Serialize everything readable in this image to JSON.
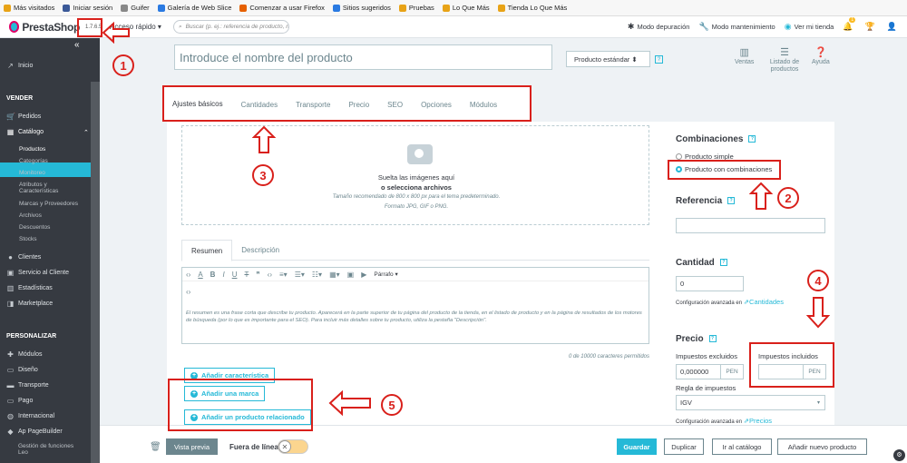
{
  "bookmarks": [
    {
      "label": "Más visitados",
      "color": "#e8a317"
    },
    {
      "label": "Iniciar sesión",
      "color": "#3b5998"
    },
    {
      "label": "Guifer",
      "color": "#888888"
    },
    {
      "label": "Galería de Web Slice",
      "color": "#2a7ae2"
    },
    {
      "label": "Comenzar a usar Firefox",
      "color": "#e66000"
    },
    {
      "label": "Sitios sugeridos",
      "color": "#2a7ae2"
    },
    {
      "label": "Pruebas",
      "color": "#e8a317"
    },
    {
      "label": "Lo Que Más",
      "color": "#e8a317"
    },
    {
      "label": "Tienda Lo Que Más",
      "color": "#e8a317"
    }
  ],
  "header": {
    "logo": "PrestaShop",
    "version": "1.7.6.5",
    "quick_access": "Acceso rápido ▾",
    "search_placeholder": "Buscar (p. ej.: referencia de producto, n",
    "debug": "Modo depuración",
    "maintenance": "Modo mantenimiento",
    "view_store": "Ver mi tienda",
    "notif_count": "1"
  },
  "sidebar": {
    "collapse": "«",
    "home": "Inicio",
    "sell": "VENDER",
    "orders": "Pedidos",
    "catalog": "Catálogo",
    "catalog_sub": [
      "Productos",
      "Categorías",
      "Monitoreo",
      "Atributos y Características",
      "Marcas y Proveedores",
      "Archivos",
      "Descuentos",
      "Stocks"
    ],
    "customers": "Clientes",
    "service": "Servicio al Cliente",
    "stats": "Estadísticas",
    "marketplace": "Marketplace",
    "customize": "PERSONALIZAR",
    "modules": "Módulos",
    "design": "Diseño",
    "shipping": "Transporte",
    "payment": "Pago",
    "international": "Internacional",
    "pagebuilder": "Ap PageBuilder",
    "leo": "Gestión de funciones Leo"
  },
  "product": {
    "name_placeholder": "Introduce el nombre del producto",
    "type": "Producto estándar  ⬍",
    "toolbar": {
      "sales": "Ventas",
      "list": "Listado de productos",
      "help": "Ayuda"
    }
  },
  "tabs": [
    "Ajustes básicos",
    "Cantidades",
    "Transporte",
    "Precio",
    "SEO",
    "Opciones",
    "Módulos"
  ],
  "images": {
    "drop1": "Suelta las imágenes aquí",
    "drop2": "o selecciona archivos",
    "hint1": "Tamaño recomendado de 800 x 800 px para el tema predeterminado.",
    "hint2": "Formato JPG, GIF o PNG."
  },
  "editor": {
    "tab_summary": "Resumen",
    "tab_desc": "Descripción",
    "paragraph": "Párrafo ▾",
    "help_text": "El resumen es una frase corta que describe tu producto. Aparecerá en la parte superior de tu página del producto de la tienda, en el listado de producto y en la página de resultados de los motores de búsqueda (por lo que es importante para el SEO). Para incluir más detalles sobre tu producto, utiliza la pestaña \"Descripción\".",
    "counter": "0 de 10000 caracteres permitidos"
  },
  "buttons": {
    "feature": "Añadir característica",
    "brand": "Añadir una marca",
    "related": "Añadir un producto relacionado"
  },
  "right": {
    "combinations": "Combinaciones",
    "simple": "Producto simple",
    "with_comb": "Producto con combinaciones",
    "reference": "Referencia",
    "quantity": "Cantidad",
    "qty_value": "0",
    "adv_config": "Configuración avanzada en",
    "qty_link": "Cantidades",
    "price": "Precio",
    "tax_excl": "Impuestos excluidos",
    "tax_incl": "Impuestos incluidos",
    "price_value": "0,000000",
    "currency": "PEN",
    "tax_rule": "Regla de impuestos",
    "tax_value": "IGV",
    "price_link": "Precios"
  },
  "bottom": {
    "preview": "Vista previa",
    "offline": "Fuera de línea",
    "save": "Guardar",
    "duplicate": "Duplicar",
    "catalog": "Ir al catálogo",
    "add_new": "Añadir nuevo producto"
  },
  "annotations": [
    "1",
    "2",
    "3",
    "4",
    "5"
  ],
  "colors": {
    "accent": "#25b9d7",
    "sidebar": "#363a41",
    "annotation": "#d9201b"
  }
}
